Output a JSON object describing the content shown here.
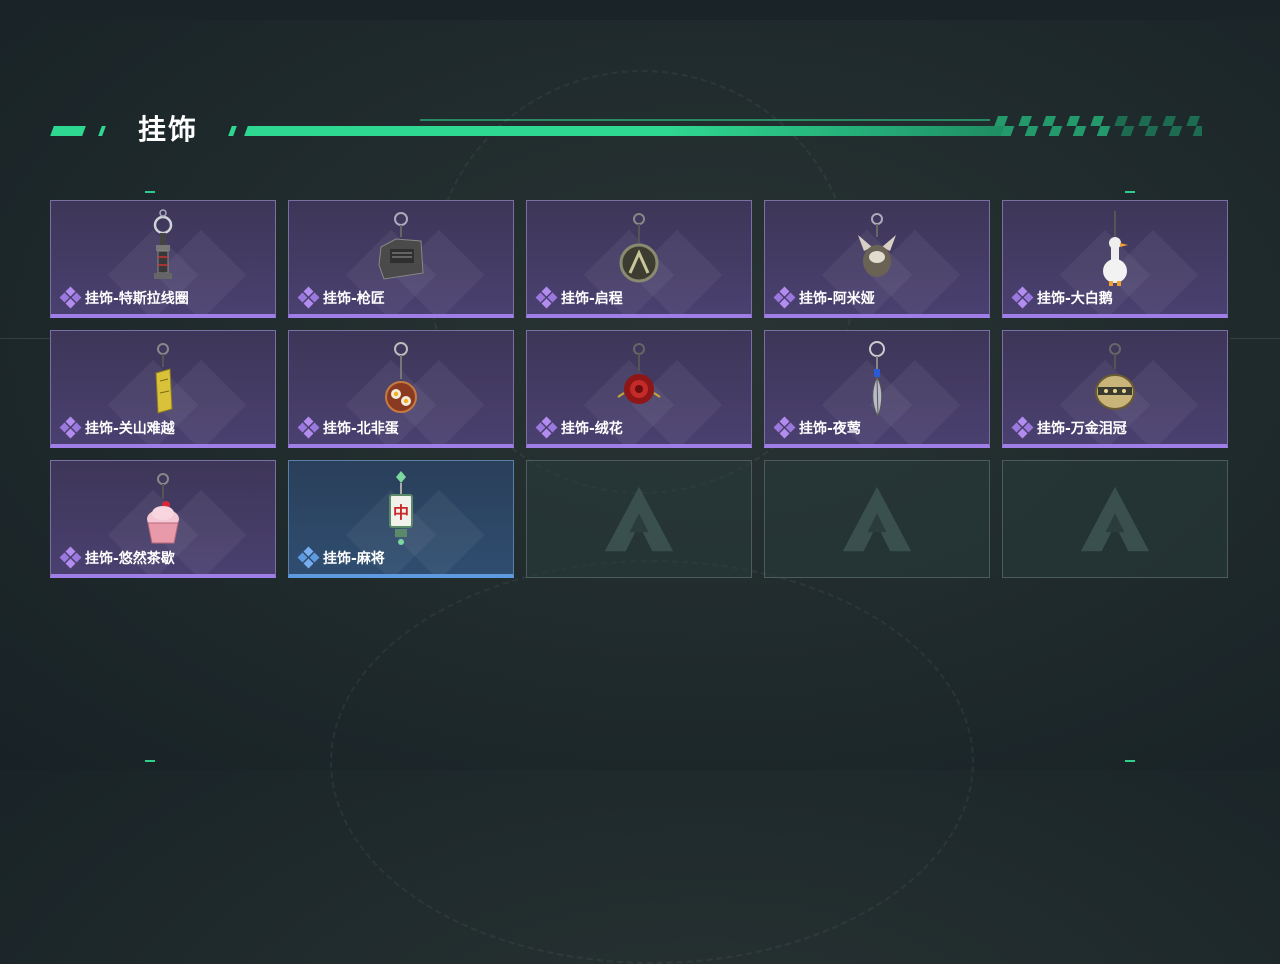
{
  "section": {
    "title": "挂饰"
  },
  "colors": {
    "accent": "#2fd891",
    "purple_rarity": "#a07ee8",
    "blue_rarity": "#5d9ae0"
  },
  "items": [
    {
      "label": "挂饰-特斯拉线圈",
      "rarity": "purple",
      "icon": "tesla-coil-charm-icon"
    },
    {
      "label": "挂饰-枪匠",
      "rarity": "purple",
      "icon": "gunsmith-charm-icon"
    },
    {
      "label": "挂饰-启程",
      "rarity": "purple",
      "icon": "departure-charm-icon"
    },
    {
      "label": "挂饰-阿米娅",
      "rarity": "purple",
      "icon": "amiya-charm-icon"
    },
    {
      "label": "挂饰-大白鹅",
      "rarity": "purple",
      "icon": "white-goose-charm-icon"
    },
    {
      "label": "挂饰-关山难越",
      "rarity": "purple",
      "icon": "gold-bar-charm-icon"
    },
    {
      "label": "挂饰-北非蛋",
      "rarity": "purple",
      "icon": "shakshuka-charm-icon"
    },
    {
      "label": "挂饰-绒花",
      "rarity": "purple",
      "icon": "velvet-flower-charm-icon"
    },
    {
      "label": "挂饰-夜莺",
      "rarity": "purple",
      "icon": "nightingale-feather-charm-icon"
    },
    {
      "label": "挂饰-万金泪冠",
      "rarity": "purple",
      "icon": "crown-charm-icon"
    },
    {
      "label": "挂饰-悠然茶歇",
      "rarity": "purple",
      "icon": "cupcake-charm-icon"
    },
    {
      "label": "挂饰-麻将",
      "rarity": "blue",
      "icon": "mahjong-tile-charm-icon"
    },
    {
      "label": "",
      "rarity": "empty",
      "icon": "empty-slot-logo-icon"
    },
    {
      "label": "",
      "rarity": "empty",
      "icon": "empty-slot-logo-icon"
    },
    {
      "label": "",
      "rarity": "empty",
      "icon": "empty-slot-logo-icon"
    }
  ]
}
